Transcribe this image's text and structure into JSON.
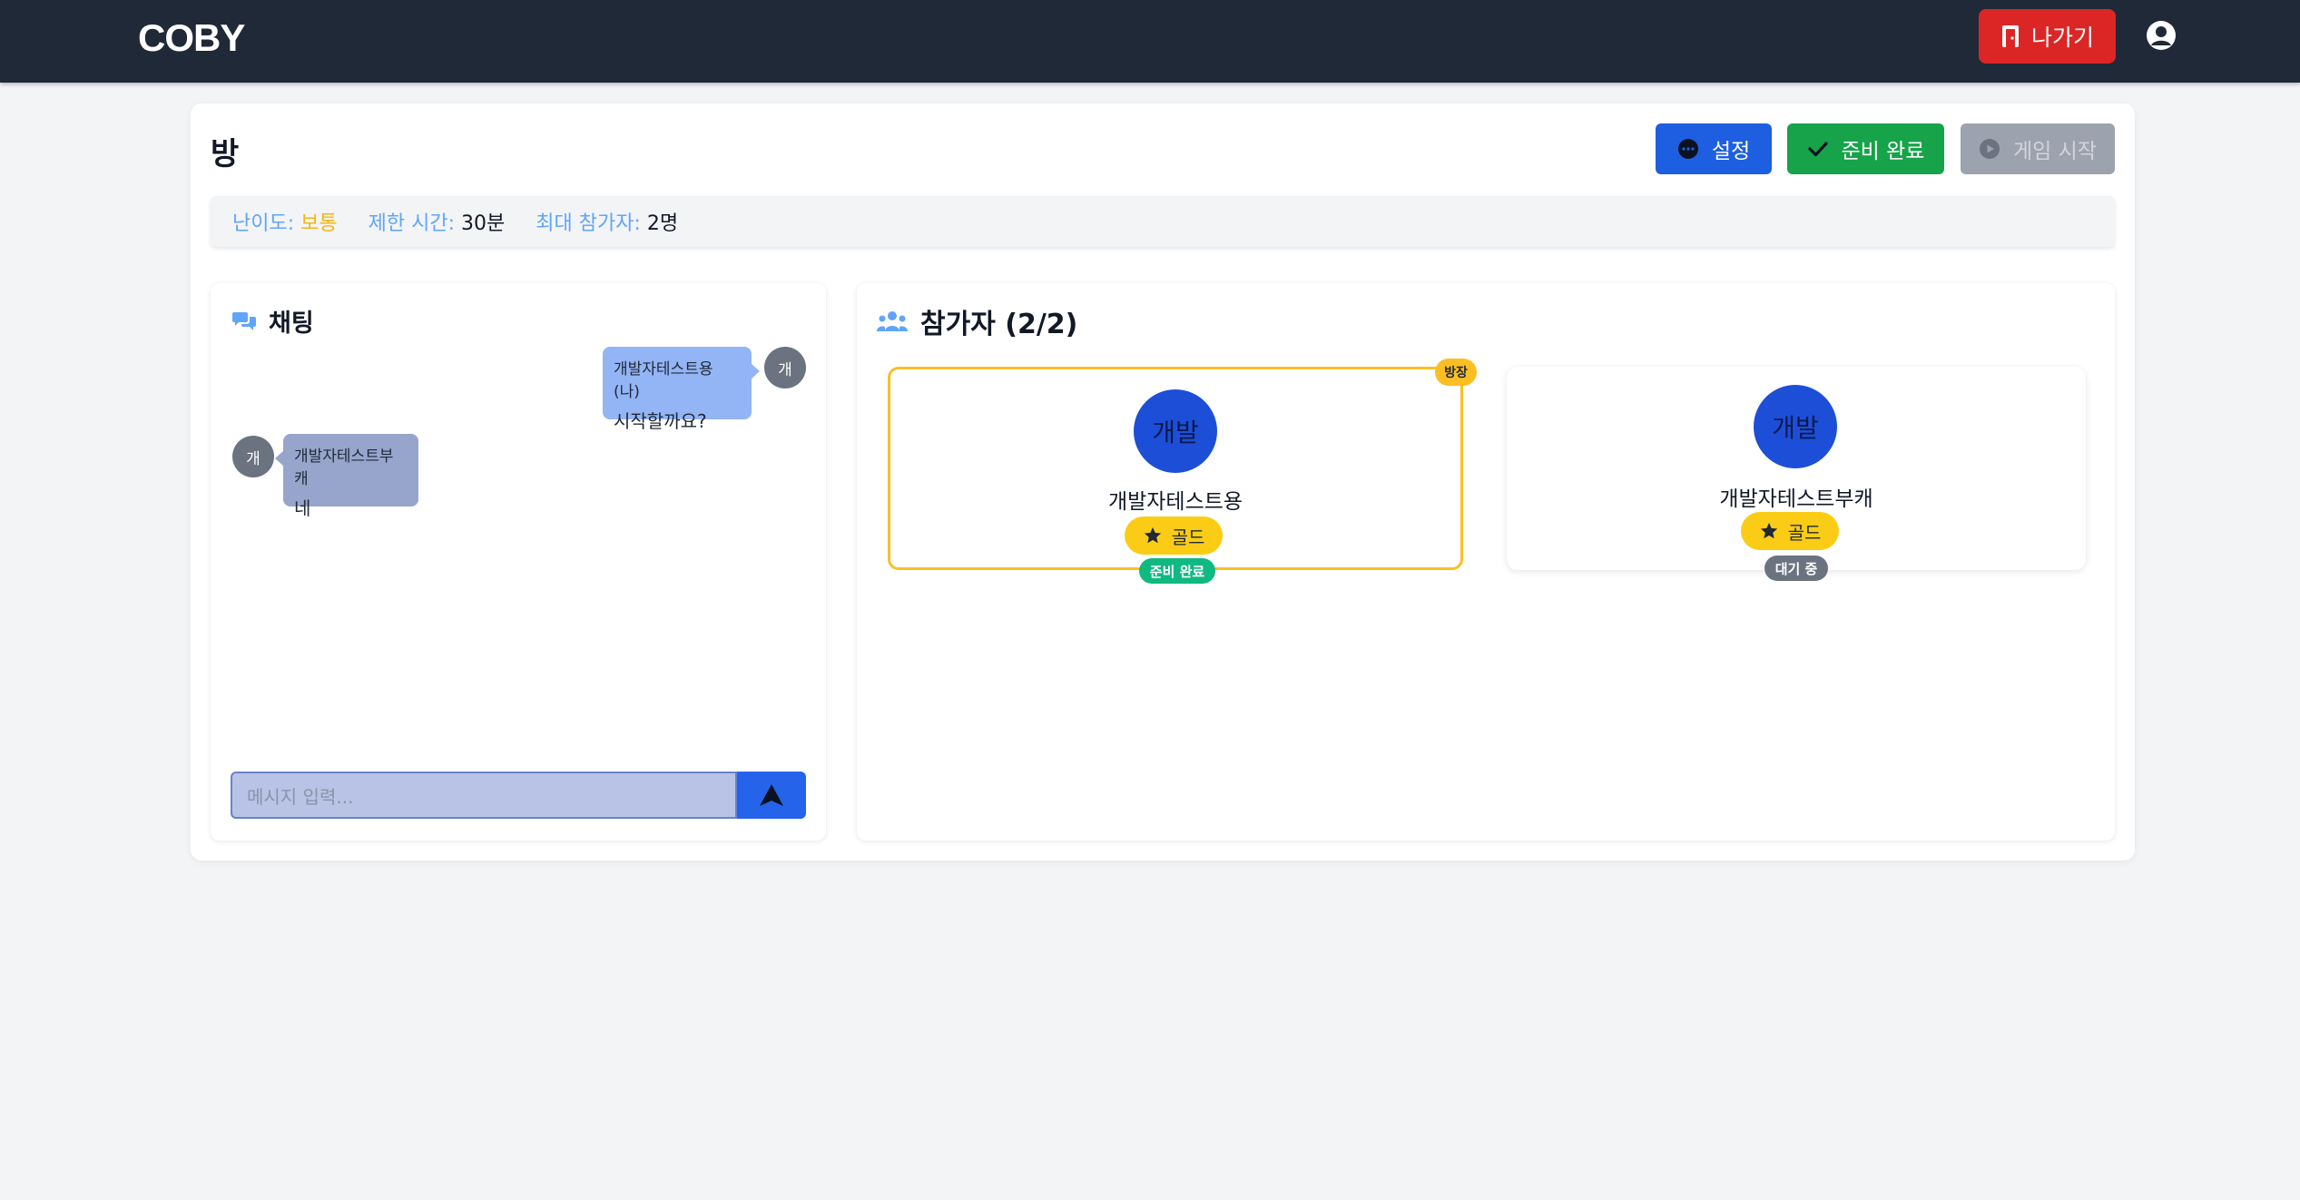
{
  "header": {
    "logo": "COBY",
    "exit_label": "나가기"
  },
  "room": {
    "title": "방",
    "buttons": {
      "settings": "설정",
      "ready": "준비 완료",
      "start": "게임 시작"
    },
    "info": {
      "difficulty_label": "난이도:",
      "difficulty_value": "보통",
      "time_label": "제한 시간:",
      "time_value": "30분",
      "max_label": "최대 참가자:",
      "max_value": "2명"
    }
  },
  "chat": {
    "title": "채팅",
    "messages": [
      {
        "avatar": "개",
        "sender": "개발자테스트용 (나)",
        "text": "시작할까요?",
        "mine": true
      },
      {
        "avatar": "개",
        "sender": "개발자테스트부캐",
        "text": "네",
        "mine": false
      }
    ],
    "input_placeholder": "메시지 입력..."
  },
  "participants": {
    "title": "참가자 (2/2)",
    "list": [
      {
        "avatar": "개발",
        "name": "개발자테스트용",
        "tier": "골드",
        "status": "준비 완료",
        "host_badge": "방장"
      },
      {
        "avatar": "개발",
        "name": "개발자테스트부캐",
        "tier": "골드",
        "status": "대기 중"
      }
    ]
  },
  "colors": {
    "header_bg": "#1f2937",
    "exit_red": "#dc2626",
    "settings_blue": "#1d5fe0",
    "ready_green": "#16a34a",
    "start_disabled": "#9ca3af",
    "host_gold": "#fbbf24",
    "tier_gold": "#facc15"
  }
}
